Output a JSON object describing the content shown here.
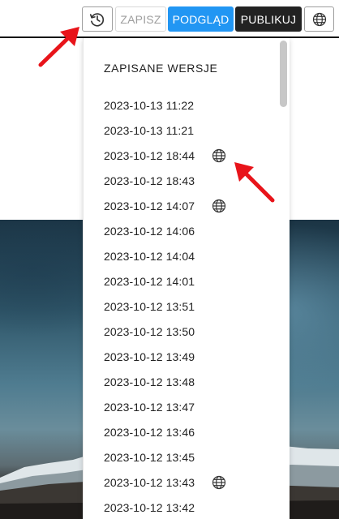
{
  "toolbar": {
    "history_icon": "history-icon",
    "save_label": "ZAPISZ",
    "preview_label": "PODGLĄD",
    "publish_label": "PUBLIKUJ",
    "language_icon": "globe-icon",
    "colors": {
      "preview": "#2196f3",
      "publish": "#222222",
      "save_disabled": "#9e9e9e"
    }
  },
  "versions_panel": {
    "title": "ZAPISANE WERSJE",
    "published_icon": "globe-icon",
    "items": [
      {
        "timestamp": "2023-10-13 11:22",
        "published": false
      },
      {
        "timestamp": "2023-10-13 11:21",
        "published": false
      },
      {
        "timestamp": "2023-10-12 18:44",
        "published": true
      },
      {
        "timestamp": "2023-10-12 18:43",
        "published": false
      },
      {
        "timestamp": "2023-10-12 14:07",
        "published": true
      },
      {
        "timestamp": "2023-10-12 14:06",
        "published": false
      },
      {
        "timestamp": "2023-10-12 14:04",
        "published": false
      },
      {
        "timestamp": "2023-10-12 14:01",
        "published": false
      },
      {
        "timestamp": "2023-10-12 13:51",
        "published": false
      },
      {
        "timestamp": "2023-10-12 13:50",
        "published": false
      },
      {
        "timestamp": "2023-10-12 13:49",
        "published": false
      },
      {
        "timestamp": "2023-10-12 13:48",
        "published": false
      },
      {
        "timestamp": "2023-10-12 13:47",
        "published": false
      },
      {
        "timestamp": "2023-10-12 13:46",
        "published": false
      },
      {
        "timestamp": "2023-10-12 13:45",
        "published": false
      },
      {
        "timestamp": "2023-10-12 13:43",
        "published": true
      },
      {
        "timestamp": "2023-10-12 13:42",
        "published": false
      }
    ]
  },
  "annotations": {
    "arrow_color": "#e8141a"
  }
}
